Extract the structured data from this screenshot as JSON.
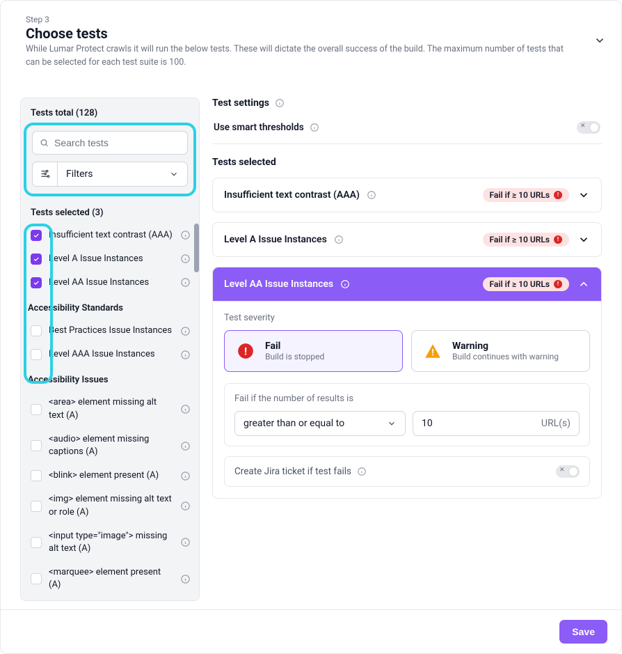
{
  "header": {
    "step": "Step 3",
    "title": "Choose tests",
    "description": "While Lumar Protect crawls it will run the below tests. These will dictate the overall success of the build. The maximum number of tests that can be selected for each test suite is 100."
  },
  "sidebar": {
    "totals_label": "Tests total (128)",
    "search_placeholder": "Search tests",
    "filters_label": "Filters",
    "selected_label": "Tests selected (3)",
    "selected_items": [
      {
        "label": "Insufficient text contrast (AAA)",
        "checked": true
      },
      {
        "label": "Level A Issue Instances",
        "checked": true
      },
      {
        "label": "Level AA Issue Instances",
        "checked": true
      }
    ],
    "groups": [
      {
        "title": "Accessibility Standards",
        "items": [
          {
            "label": "Best Practices Issue Instances",
            "checked": false
          },
          {
            "label": "Level AAA Issue Instances",
            "checked": false
          }
        ]
      },
      {
        "title": "Accessibility Issues",
        "items": [
          {
            "label": "<area> element missing alt text (A)",
            "checked": false
          },
          {
            "label": "<audio> element missing captions (A)",
            "checked": false
          },
          {
            "label": "<blink> element present (A)",
            "checked": false
          },
          {
            "label": "<img> element missing alt text or role (A)",
            "checked": false
          },
          {
            "label": "<input type=\"image\"> missing alt text (A)",
            "checked": false
          },
          {
            "label": "<marquee> element present (A)",
            "checked": false
          }
        ]
      }
    ]
  },
  "main": {
    "settings_title": "Test settings",
    "smart_label": "Use smart thresholds",
    "selected_title": "Tests selected",
    "tests": [
      {
        "title": "Insufficient text contrast (AAA)",
        "pill": "Fail if ≥ 10 URLs",
        "expanded": false
      },
      {
        "title": "Level A Issue Instances",
        "pill": "Fail if ≥ 10 URLs",
        "expanded": false
      },
      {
        "title": "Level AA Issue Instances",
        "pill": "Fail if ≥ 10 URLs",
        "expanded": true
      }
    ],
    "expanded": {
      "severity_label": "Test severity",
      "fail_title": "Fail",
      "fail_sub": "Build is stopped",
      "warn_title": "Warning",
      "warn_sub": "Build continues with warning",
      "cond_label": "Fail if the number of results is",
      "operator": "greater than or equal to",
      "value": "10",
      "unit": "URL(s)",
      "jira_label": "Create Jira ticket if test fails"
    }
  },
  "footer": {
    "save": "Save"
  }
}
